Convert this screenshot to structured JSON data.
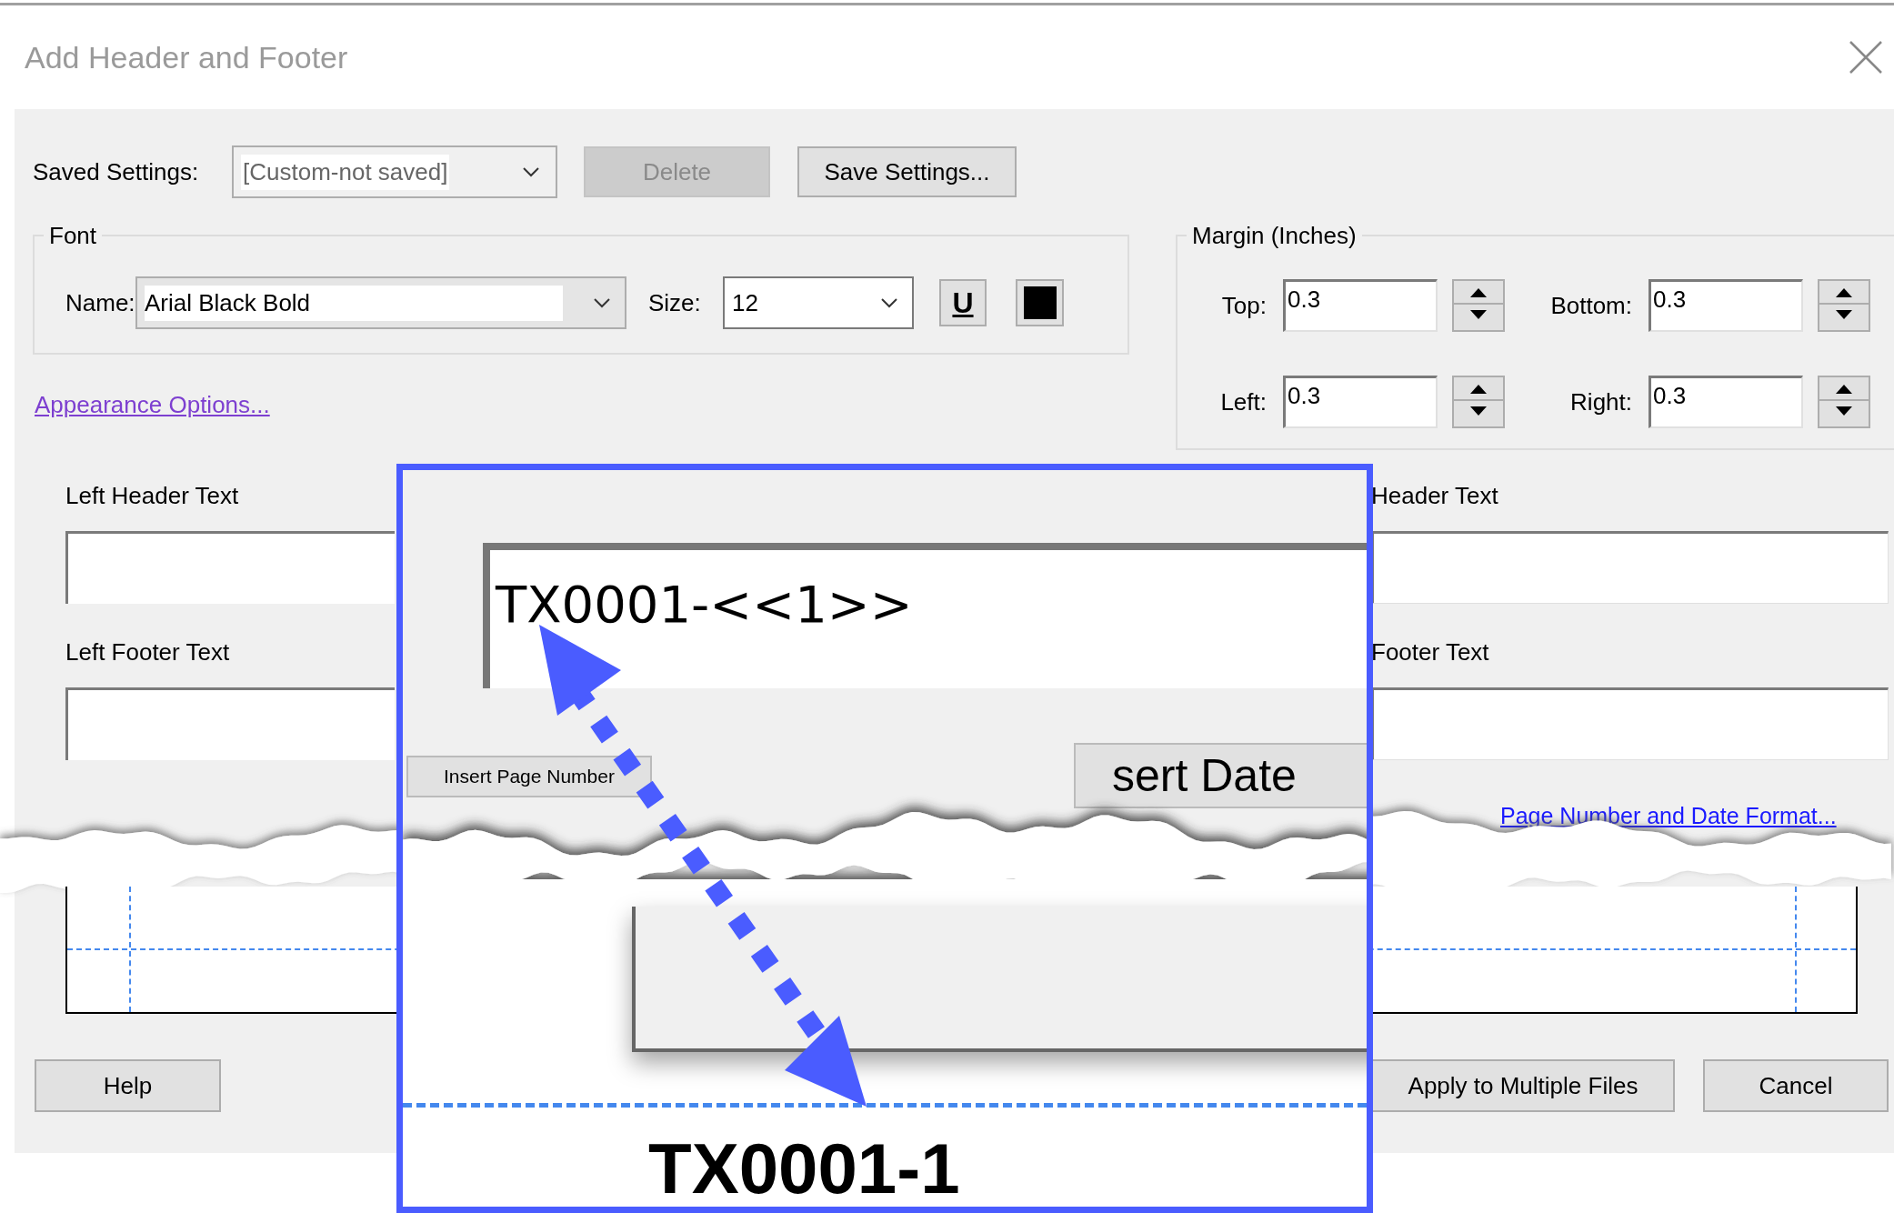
{
  "window": {
    "title": "Add Header and Footer"
  },
  "saved_settings": {
    "label": "Saved Settings:",
    "value": "[Custom-not saved]",
    "buttons": [
      {
        "label": "Delete",
        "disabled": true
      },
      {
        "label": "Save Settings...",
        "disabled": false
      }
    ]
  },
  "font": {
    "group": "Font",
    "name_label": "Name:",
    "name": "Arial Black Bold",
    "size_label": "Size:",
    "size": "12",
    "underline": "U"
  },
  "appearance_link": "Appearance Options...",
  "margin": {
    "group": "Margin (Inches)",
    "fields": [
      {
        "label": "Top:",
        "value": "0.3"
      },
      {
        "label": "Bottom:",
        "value": "0.3"
      },
      {
        "label": "Left:",
        "value": "0.3"
      },
      {
        "label": "Right:",
        "value": "0.3"
      }
    ]
  },
  "left_fields": [
    {
      "label": "Left Header Text"
    },
    {
      "label": "Left Footer Text"
    }
  ],
  "right_fields": [
    {
      "label": "Header Text"
    },
    {
      "label": "Footer Text"
    }
  ],
  "torn_strip": {
    "button": "Insert Page Number",
    "link": "Page Number and Date Format..."
  },
  "footer_buttons": [
    {
      "label": "Help"
    },
    {
      "label": "Apply to Multiple Files"
    },
    {
      "label": "Cancel"
    }
  ],
  "callout": {
    "field_value": "TX0001-<<1>>",
    "button_fragment": "sert Date",
    "result": "TX0001-1"
  }
}
